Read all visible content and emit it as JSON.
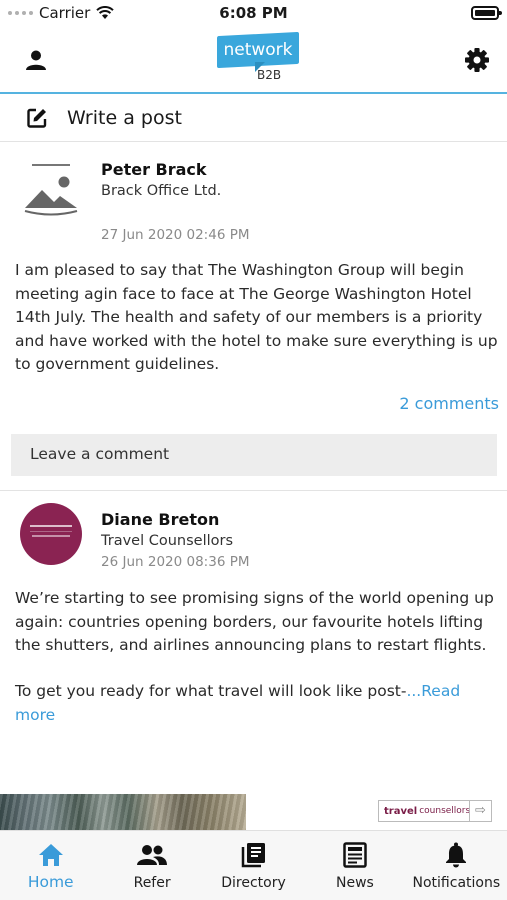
{
  "status_bar": {
    "carrier": "Carrier",
    "time": "6:08 PM"
  },
  "header": {
    "logo": {
      "word": "network",
      "sub": "B2B"
    },
    "profile_icon": "user-icon",
    "settings_icon": "gear-icon"
  },
  "composer": {
    "label": "Write a post",
    "icon": "edit-icon"
  },
  "posts": [
    {
      "author": "Peter Brack",
      "company": "Brack Office Ltd.",
      "date": "27 Jun 2020 02:46 PM",
      "body": "I am pleased to say that The Washington Group will begin meeting agin face to face at The George Washington Hotel 14th July. The health and safety of our members is a priority and have worked with the hotel to make sure everything is up to government guidelines.",
      "comments_link": "2 comments",
      "comment_placeholder": "Leave a comment"
    },
    {
      "author": "Diane Breton",
      "company": "Travel Counsellors",
      "date": "26 Jun 2020 08:36 PM",
      "body_p1": "We’re starting to see promising signs of the world opening up again: countries opening borders, our favourite hotels lifting the shutters, and airlines announcing plans to restart flights.",
      "body_p2": "To get you ready for what travel will look like post-",
      "read_more": "...Read more"
    }
  ],
  "ad": {
    "brand_bold": "travel",
    "brand_light": "counsellors"
  },
  "tabs": [
    {
      "label": "Home",
      "icon": "home-icon",
      "active": true
    },
    {
      "label": "Refer",
      "icon": "people-icon",
      "active": false
    },
    {
      "label": "Directory",
      "icon": "book-icon",
      "active": false
    },
    {
      "label": "News",
      "icon": "newspaper-icon",
      "active": false
    },
    {
      "label": "Notifications",
      "icon": "bell-icon",
      "active": false
    }
  ],
  "colors": {
    "accent": "#3a9bd9",
    "logo_blue": "#3aa7dc",
    "brand_magenta": "#8a2352"
  }
}
